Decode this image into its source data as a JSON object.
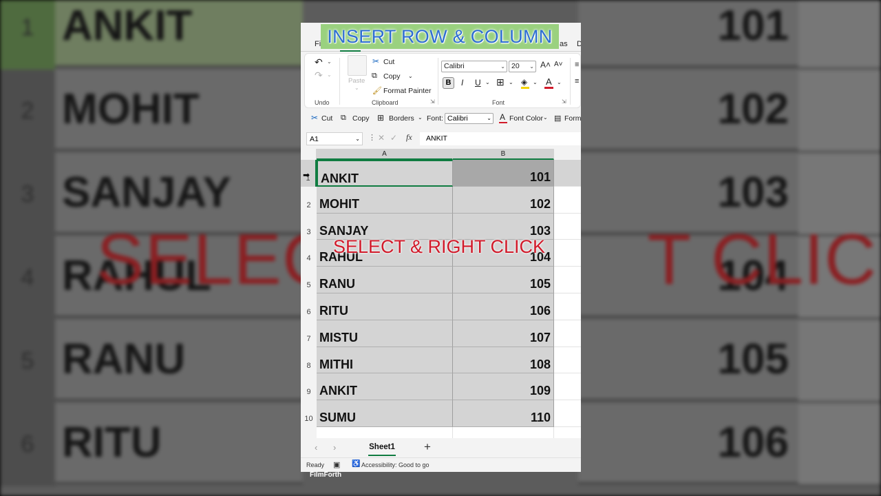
{
  "overlay": {
    "title": "INSERT ROW & COLUMN",
    "instruction": "SELECT & RIGHT CLICK",
    "watermark": "FilmForth"
  },
  "background_zoom": {
    "row_numbers": [
      "1",
      "2",
      "3",
      "4",
      "5",
      "6"
    ],
    "names": [
      "ANKIT",
      "MOHIT",
      "SANJAY",
      "RAHUL",
      "RANU",
      "RITU"
    ],
    "numbers": [
      "101",
      "102",
      "103",
      "104",
      "105",
      "106"
    ],
    "instruction_fragments": [
      "SELECT",
      "T CLICK"
    ]
  },
  "tabs": {
    "left_fragment": "Fil",
    "right_fragment": "as",
    "far_right_fragment": "D"
  },
  "ribbon": {
    "undo_label": "Undo",
    "paste_label": "Paste",
    "cut_label": "Cut",
    "copy_label": "Copy",
    "format_painter_label": "Format Painter",
    "clipboard_group": "Clipboard",
    "font_name": "Calibri",
    "font_size": "20",
    "bold": "B",
    "italic": "I",
    "underline": "U",
    "font_group": "Font"
  },
  "quickbar": {
    "cut": "Cut",
    "copy": "Copy",
    "borders": "Borders",
    "font_label": "Font:",
    "font_value": "Calibri",
    "font_color": "Font Color",
    "format_fragment": "Form"
  },
  "formula_bar": {
    "name_box": "A1",
    "fx": "fx",
    "content": "ANKIT"
  },
  "sheet": {
    "columns": [
      "A",
      "B"
    ],
    "rows": [
      {
        "num": "1",
        "name": "ANKIT",
        "value": "101"
      },
      {
        "num": "2",
        "name": "MOHIT",
        "value": "102"
      },
      {
        "num": "3",
        "name": "SANJAY",
        "value": "103"
      },
      {
        "num": "4",
        "name": "RAHUL",
        "value": "104"
      },
      {
        "num": "5",
        "name": "RANU",
        "value": "105"
      },
      {
        "num": "6",
        "name": "RITU",
        "value": "106"
      },
      {
        "num": "7",
        "name": "MISTU",
        "value": "107"
      },
      {
        "num": "8",
        "name": "MITHI",
        "value": "108"
      },
      {
        "num": "9",
        "name": "ANKIT",
        "value": "109"
      },
      {
        "num": "10",
        "name": "SUMU",
        "value": "110"
      }
    ]
  },
  "sheet_tabs": {
    "active": "Sheet1",
    "add": "+"
  },
  "status": {
    "ready": "Ready",
    "accessibility": "Accessibility: Good to go"
  },
  "colors": {
    "excel_green": "#107c41",
    "title_blue": "#2d6ed1",
    "title_bg": "#9ad17f",
    "instruction_red": "#d11a2a"
  }
}
